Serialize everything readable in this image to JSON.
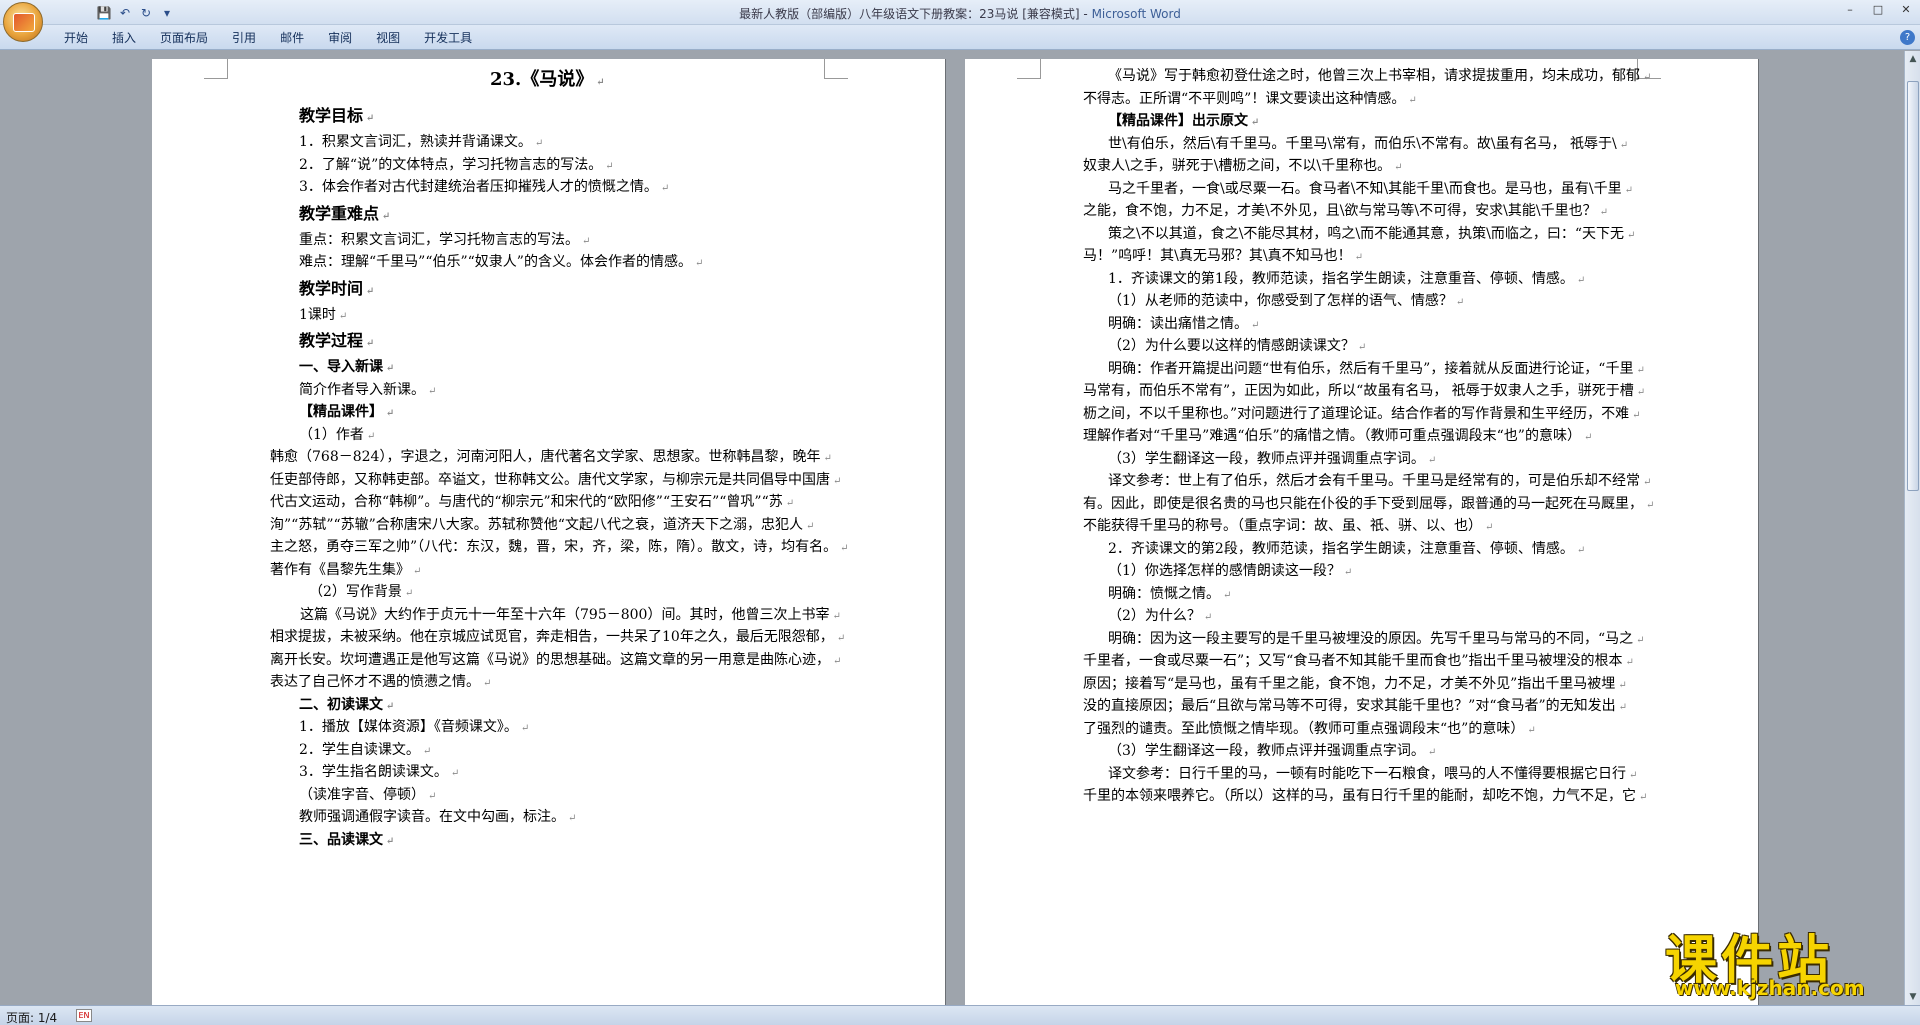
{
  "window": {
    "title_doc": "最新人教版（部编版）八年级语文下册教案：23马说 [兼容模式]",
    "title_sep": " - ",
    "title_app": "Microsoft Word"
  },
  "qat": {
    "save": "💾",
    "undo": "↶",
    "redo": "↻",
    "more": "▾"
  },
  "winctrl": {
    "min": "–",
    "max": "□",
    "close": "✕"
  },
  "ribbon": {
    "tabs": [
      "开始",
      "插入",
      "页面布局",
      "引用",
      "邮件",
      "审阅",
      "视图",
      "开发工具"
    ],
    "help": "?"
  },
  "page1": {
    "lines": [
      {
        "t": "23.《马说》",
        "k": "title"
      },
      {
        "t": "教学目标",
        "k": "h"
      },
      {
        "t": "1．积累文言词汇，熟读并背诵课文。",
        "k": "n"
      },
      {
        "t": "2．了解“说”的文体特点，学习托物言志的写法。",
        "k": "n"
      },
      {
        "t": "3．体会作者对古代封建统治者压抑摧残人才的愤慨之情。",
        "k": "n"
      },
      {
        "t": "教学重难点",
        "k": "h"
      },
      {
        "t": "重点：积累文言词汇，学习托物言志的写法。",
        "k": "n"
      },
      {
        "t": "难点：理解“千里马”“伯乐”“奴隶人”的含义。体会作者的情感。",
        "k": "n"
      },
      {
        "t": "教学时间",
        "k": "h"
      },
      {
        "t": "1课时",
        "k": "n"
      },
      {
        "t": "教学过程",
        "k": "h"
      },
      {
        "t": "一、导入新课",
        "k": "b"
      },
      {
        "t": "简介作者导入新课。",
        "k": "n"
      },
      {
        "t": "【精品课件】",
        "k": "b"
      },
      {
        "t": "（1）作者",
        "k": "n"
      },
      {
        "t": "韩愈（768－824），字退之，河南河阳人，唐代著名文学家、思想家。世称韩昌黎，晚年",
        "k": "w"
      },
      {
        "t": "任吏部侍郎，又称韩吏部。卒谥文，世称韩文公。唐代文学家，与柳宗元是共同倡导中国唐",
        "k": "w"
      },
      {
        "t": "代古文运动，合称“韩柳”。与唐代的“柳宗元”和宋代的“欧阳修”“王安石”“曾巩”“苏",
        "k": "w"
      },
      {
        "t": "洵”“苏轼”“苏辙”合称唐宋八大家。苏轼称赞他“文起八代之衰，道济天下之溺，忠犯人",
        "k": "w"
      },
      {
        "t": "主之怒，勇夺三军之帅”（八代：东汉，魏，晋，宋，齐，梁，陈，隋）。散文，诗，均有名。",
        "k": "w"
      },
      {
        "t": "著作有《昌黎先生集》",
        "k": "w"
      },
      {
        "t": "（2）写作背景",
        "k": "n2"
      },
      {
        "t": "这篇《马说》大约作于贞元十一年至十六年（795－800）间。其时，他曾三次上书宰",
        "k": "w2"
      },
      {
        "t": "相求提拔，未被采纳。他在京城应试觅官，奔走相告，一共呆了10年之久，最后无限怨郁，",
        "k": "w"
      },
      {
        "t": "离开长安。坎坷遭遇正是他写这篇《马说》的思想基础。这篇文章的另一用意是曲陈心迹，",
        "k": "w"
      },
      {
        "t": "表达了自己怀才不遇的愤懑之情。",
        "k": "w"
      },
      {
        "t": "二、初读课文",
        "k": "b"
      },
      {
        "t": "1．播放【媒体资源】《音频课文》。",
        "k": "n"
      },
      {
        "t": "2．学生自读课文。",
        "k": "n"
      },
      {
        "t": "3．学生指名朗读课文。",
        "k": "n"
      },
      {
        "t": "（读准字音、停顿）",
        "k": "n"
      },
      {
        "t": "教师强调通假字读音。在文中勾画，标注。",
        "k": "n"
      },
      {
        "t": "三、品读课文",
        "k": "b"
      }
    ]
  },
  "page2": {
    "lines": [
      {
        "t": "《马说》写于韩愈初登仕途之时，他曾三次上书宰相，请求提拔重用，均未成功，郁郁",
        "k": "i"
      },
      {
        "t": "不得志。正所谓“不平则鸣”！课文要读出这种情感。",
        "k": "w"
      },
      {
        "t": "【精品课件】出示原文",
        "k": "ib"
      },
      {
        "t": "世\\有伯乐，然后\\有千里马。千里马\\常有，而伯乐\\不常有。故\\虽有名马， 祇辱于\\",
        "k": "i"
      },
      {
        "t": "奴隶人\\之手，骈死于\\槽枥之间，不以\\千里称也。",
        "k": "w"
      },
      {
        "t": "马之千里者，一食\\或尽粟一石。食马者\\不知\\其能千里\\而食也。是马也，虽有\\千里",
        "k": "i"
      },
      {
        "t": "之能，食不饱，力不足，才美\\不外见，且\\欲与常马等\\不可得，安求\\其能\\千里也？",
        "k": "w"
      },
      {
        "t": "策之\\不以其道，食之\\不能尽其材，鸣之\\而不能通其意，执策\\而临之，曰：“天下无",
        "k": "i"
      },
      {
        "t": "马！”呜呼！其\\真无马邪？其\\真不知马也！",
        "k": "w"
      },
      {
        "t": "1．齐读课文的第1段，教师范读，指名学生朗读，注意重音、停顿、情感。",
        "k": "i"
      },
      {
        "t": "（1）从老师的范读中，你感受到了怎样的语气、情感？",
        "k": "i"
      },
      {
        "t": "明确：读出痛惜之情。",
        "k": "i"
      },
      {
        "t": "（2）为什么要以这样的情感朗读课文？",
        "k": "i"
      },
      {
        "t": "明确：作者开篇提出问题“世有伯乐，然后有千里马”，接着就从反面进行论证，“千里",
        "k": "i"
      },
      {
        "t": "马常有，而伯乐不常有”，正因为如此，所以“故虽有名马， 祇辱于奴隶人之手，骈死于槽",
        "k": "w"
      },
      {
        "t": "枥之间，不以千里称也。”对问题进行了道理论证。结合作者的写作背景和生平经历，不难",
        "k": "w"
      },
      {
        "t": "理解作者对“千里马”难遇“伯乐”的痛惜之情。（教师可重点强调段末“也”的意味）",
        "k": "w"
      },
      {
        "t": "（3）学生翻译这一段，教师点评并强调重点字词。",
        "k": "i"
      },
      {
        "t": "译文参考：世上有了伯乐，然后才会有千里马。千里马是经常有的，可是伯乐却不经常",
        "k": "i"
      },
      {
        "t": "有。因此，即使是很名贵的马也只能在仆役的手下受到屈辱，跟普通的马一起死在马厩里，",
        "k": "w"
      },
      {
        "t": "不能获得千里马的称号。（重点字词：故、虽、祇、骈、以、也）",
        "k": "w"
      },
      {
        "t": "2．齐读课文的第2段，教师范读，指名学生朗读，注意重音、停顿、情感。",
        "k": "i"
      },
      {
        "t": "（1）你选择怎样的感情朗读这一段？",
        "k": "i"
      },
      {
        "t": "明确：愤慨之情。",
        "k": "i"
      },
      {
        "t": "（2）为什么？",
        "k": "i"
      },
      {
        "t": "明确：因为这一段主要写的是千里马被埋没的原因。先写千里马与常马的不同，“马之",
        "k": "i"
      },
      {
        "t": "千里者，一食或尽粟一石”；又写“食马者不知其能千里而食也”指出千里马被埋没的根本",
        "k": "w"
      },
      {
        "t": "原因；接着写“是马也，虽有千里之能，食不饱，力不足，才美不外见”指出千里马被埋",
        "k": "w"
      },
      {
        "t": "没的直接原因；最后“且欲与常马等不可得，安求其能千里也？”对“食马者”的无知发出",
        "k": "w"
      },
      {
        "t": "了强烈的谴责。至此愤慨之情毕现。（教师可重点强调段末“也”的意味）",
        "k": "w"
      },
      {
        "t": "（3）学生翻译这一段，教师点评并强调重点字词。",
        "k": "i"
      },
      {
        "t": "译文参考：日行千里的马，一顿有时能吃下一石粮食，喂马的人不懂得要根据它日行",
        "k": "i"
      },
      {
        "t": "千里的本领来喂养它。（所以）这样的马，虽有日行千里的能耐，却吃不饱，力气不足，它",
        "k": "w"
      }
    ]
  },
  "status": {
    "page": "页面: 1/4",
    "lang": "EN"
  },
  "watermark": {
    "main": "课件站",
    "url": "www.kjzhan.com"
  },
  "para_mark": "↵"
}
